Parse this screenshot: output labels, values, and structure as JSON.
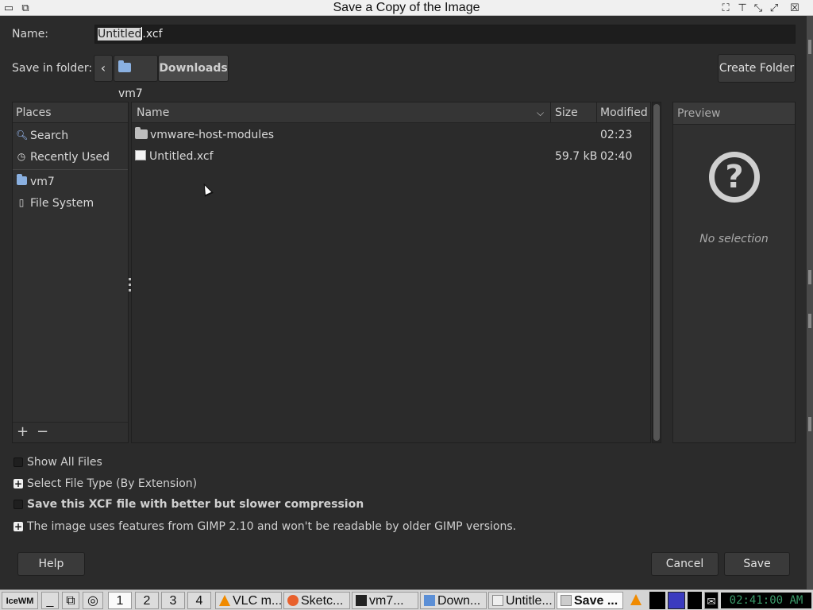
{
  "window": {
    "title": "Save a Copy of the Image"
  },
  "name_row": {
    "label": "Name:",
    "selected": "Untitled",
    "rest": ".xcf"
  },
  "folder_row": {
    "label": "Save in folder:",
    "back_icon": "chevron-left-icon",
    "crumbs": [
      "vm7",
      "Downloads"
    ],
    "create_folder": "Create Folder"
  },
  "places": {
    "header": "Places",
    "items": [
      {
        "label": "Search",
        "icon": "search-icon"
      },
      {
        "label": "Recently Used",
        "icon": "clock-icon"
      },
      {
        "label": "vm7",
        "icon": "home-folder-icon"
      },
      {
        "label": "File System",
        "icon": "drive-icon"
      }
    ]
  },
  "files": {
    "columns": {
      "name": "Name",
      "size": "Size",
      "modified": "Modified"
    },
    "rows": [
      {
        "name": "vmware-host-modules",
        "size": "",
        "modified": "02:23",
        "type": "folder"
      },
      {
        "name": "Untitled.xcf",
        "size": "59.7 kB",
        "modified": "02:40",
        "type": "file"
      }
    ]
  },
  "preview": {
    "header": "Preview",
    "empty": "No selection"
  },
  "options": {
    "show_all": "Show All Files",
    "file_type": "Select File Type (By Extension)",
    "compression": "Save this XCF file with better but slower compression",
    "compat": "The image uses features from GIMP 2.10 and won't be readable by older GIMP versions."
  },
  "buttons": {
    "help": "Help",
    "cancel": "Cancel",
    "save": "Save"
  },
  "taskbar": {
    "workspaces": [
      "1",
      "2",
      "3",
      "4"
    ],
    "tasks": [
      "VLC m...",
      "Sketc...",
      "vm7...",
      "Down...",
      "Untitle...",
      "Save ..."
    ],
    "clock": "02:41:00 AM"
  }
}
